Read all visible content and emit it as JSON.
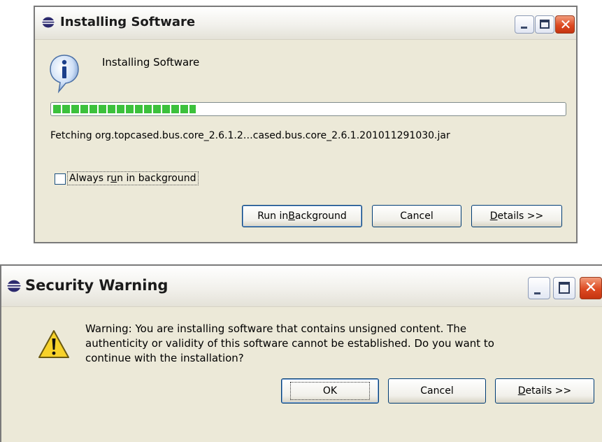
{
  "install_dialog": {
    "title": "Installing Software",
    "heading": "Installing Software",
    "progress_fraction": 0.28,
    "status_text": "Fetching org.topcased.bus.core_2.6.1.2…cased.bus.core_2.6.1.201011291030.jar",
    "checkbox": {
      "checked": false,
      "label_pre": "Always r",
      "label_u": "u",
      "label_post": "n in background"
    },
    "buttons": {
      "run_pre": "Run in ",
      "run_u": "B",
      "run_post": "ackground",
      "cancel": "Cancel",
      "details_u": "D",
      "details_post": "etails >>"
    }
  },
  "security_dialog": {
    "title": "Security Warning",
    "message_lines": [
      "Warning: You are installing software that contains unsigned content. The",
      "authenticity or validity of this software cannot be established. Do you want to",
      "continue with the installation?"
    ],
    "buttons": {
      "ok": "OK",
      "cancel": "Cancel",
      "details_u": "D",
      "details_post": "etails >>"
    }
  },
  "icons": {
    "title_icon": "eclipse-icon",
    "info_icon": "info-icon",
    "warning_icon": "warning-icon"
  },
  "colors": {
    "progress": "#3cc13c",
    "close_button": "#dd4a22"
  }
}
